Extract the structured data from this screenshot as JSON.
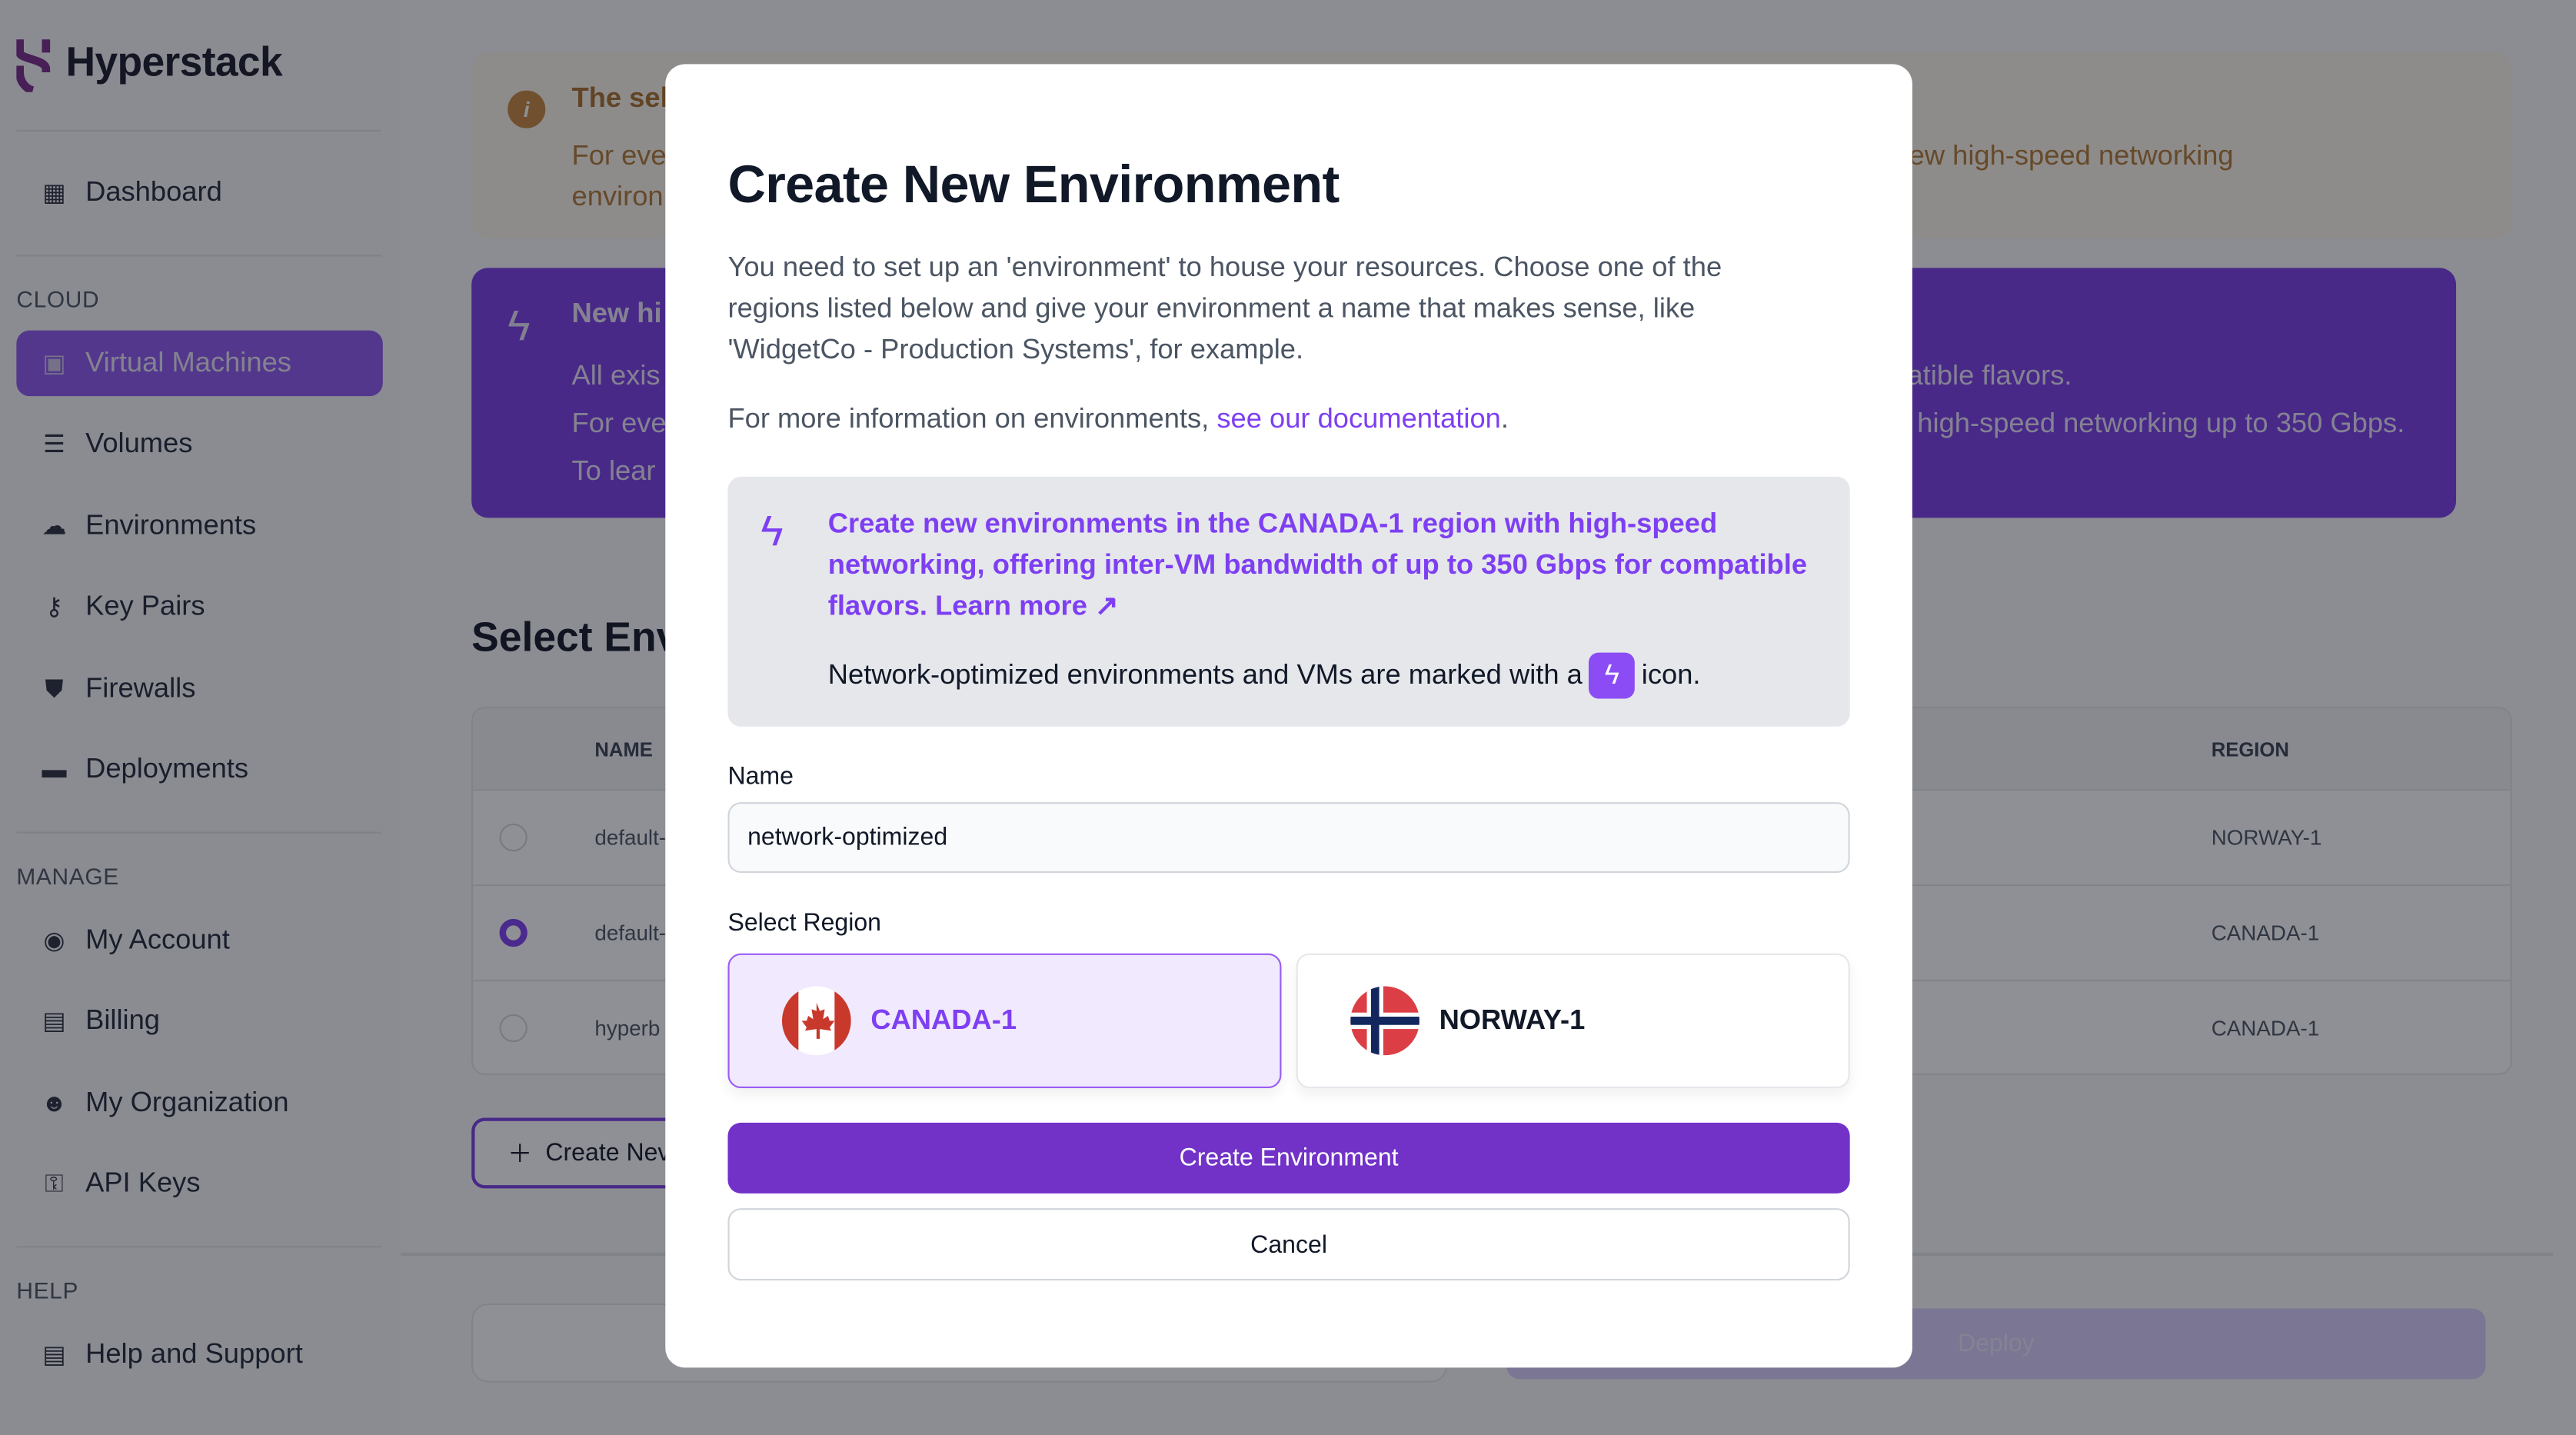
{
  "app": {
    "name": "Hyperstack"
  },
  "sidebar": {
    "items_top": [
      {
        "label": "Dashboard",
        "icon": "dashboard-icon"
      }
    ],
    "sections": [
      {
        "title": "CLOUD",
        "items": [
          {
            "label": "Virtual Machines",
            "icon": "chip-icon",
            "active": true
          },
          {
            "label": "Volumes",
            "icon": "database-icon"
          },
          {
            "label": "Environments",
            "icon": "cloud-icon"
          },
          {
            "label": "Key Pairs",
            "icon": "key-icon"
          },
          {
            "label": "Firewalls",
            "icon": "shield-icon"
          },
          {
            "label": "Deployments",
            "icon": "layers-icon"
          }
        ]
      },
      {
        "title": "MANAGE",
        "items": [
          {
            "label": "My Account",
            "icon": "user-circle-icon"
          },
          {
            "label": "Billing",
            "icon": "document-icon"
          },
          {
            "label": "My Organization",
            "icon": "users-icon"
          },
          {
            "label": "API Keys",
            "icon": "key-outline-icon"
          }
        ]
      },
      {
        "title": "HELP",
        "items": [
          {
            "label": "Help and Support",
            "icon": "document-icon"
          }
        ]
      }
    ]
  },
  "background": {
    "warning": {
      "title": "The sel",
      "line1_left": "For eve",
      "line1_right": "ew high-speed networking",
      "line2_left": "environ"
    },
    "highspeed": {
      "title": "New hi",
      "lines_left": [
        "All exis",
        "For eve",
        "To lear"
      ],
      "line1_right": "atible flavors.",
      "line2_right": "high-speed networking up to 350 Gbps."
    },
    "select_title": "Select Env",
    "table": {
      "headers": {
        "name": "NAME",
        "region": "REGION"
      },
      "rows": [
        {
          "name": "default-",
          "region": "NORWAY-1",
          "selected": false
        },
        {
          "name": "default-",
          "region": "CANADA-1",
          "selected": true
        },
        {
          "name": "hyperb",
          "region": "CANADA-1",
          "selected": false
        }
      ]
    },
    "create_new_label": "Create Nev",
    "deploy_label": "Deploy"
  },
  "modal": {
    "title": "Create New Environment",
    "description": "You need to set up an 'environment' to house your resources. Choose one of the regions listed below and give your environment a name that makes sense, like 'WidgetCo - Production Systems', for example.",
    "info_prefix": "For more information on environments, ",
    "info_link": "see our documentation",
    "info_suffix": ".",
    "callout": {
      "text": "Create new environments in the CANADA-1 region with high-speed networking, offering inter-VM bandwidth of up to 350 Gbps for compatible flavors. Learn more ↗",
      "note_prefix": "Network-optimized environments and VMs are marked with a",
      "note_suffix": "icon."
    },
    "name_label": "Name",
    "name_value": "network-optimized",
    "region_label": "Select Region",
    "regions": [
      {
        "label": "CANADA-1",
        "selected": true
      },
      {
        "label": "NORWAY-1",
        "selected": false
      }
    ],
    "create_button": "Create Environment",
    "cancel_button": "Cancel"
  },
  "colors": {
    "accent": "#7232c8",
    "link": "#7e3ff2"
  }
}
